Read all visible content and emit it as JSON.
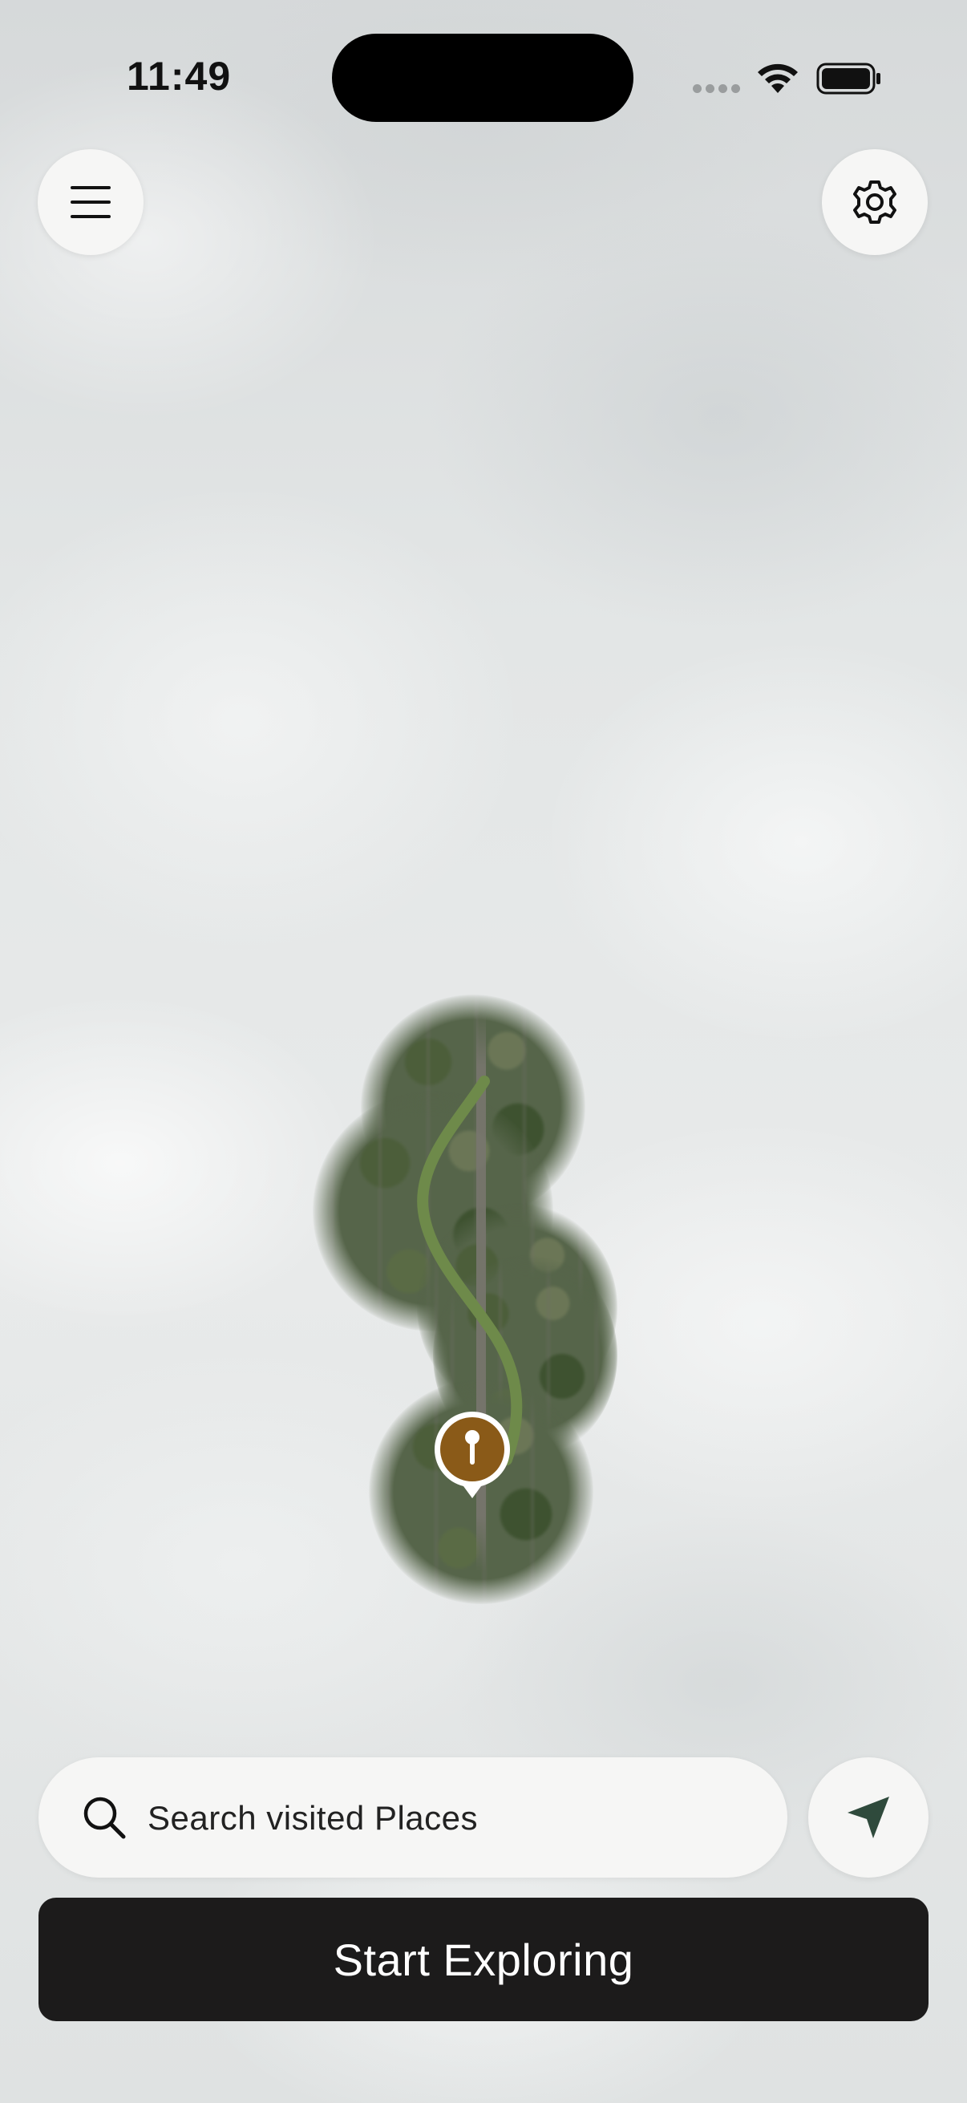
{
  "status_bar": {
    "time": "11:49"
  },
  "map": {
    "route_color": "#6e8a4a",
    "pin_color": "#8a5a18"
  },
  "top_controls": {
    "menu_icon": "hamburger-menu-icon",
    "settings_icon": "gear-icon"
  },
  "search": {
    "placeholder": "Search visited Places",
    "icon": "search-icon"
  },
  "locate": {
    "icon": "navigation-arrow-icon",
    "color": "#2f4a3c"
  },
  "primary_action": {
    "label": "Start Exploring"
  }
}
